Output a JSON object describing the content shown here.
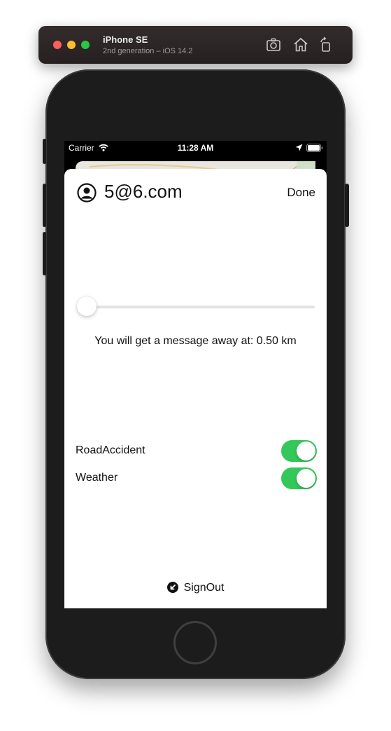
{
  "simulator": {
    "device_name": "iPhone SE",
    "device_detail": "2nd generation – iOS 14.2",
    "toolbar_icons": [
      "screenshot-icon",
      "home-icon",
      "rotate-icon"
    ]
  },
  "status_bar": {
    "carrier": "Carrier",
    "time": "11:28 AM",
    "icons": [
      "wifi-icon",
      "location-arrow-icon",
      "battery-icon"
    ]
  },
  "settings_sheet": {
    "user_email": "5@6.com",
    "done_label": "Done",
    "distance_slider": {
      "value": 0.0,
      "caption": "You will get a message away at: 0.50 km"
    },
    "toggles": [
      {
        "label": "RoadAccident",
        "on": true
      },
      {
        "label": "Weather",
        "on": true
      }
    ],
    "signout_label": "SignOut"
  },
  "colors": {
    "toggle_on": "#34c759",
    "slider_track": "#e3e3e6",
    "sheet_background": "#ffffff",
    "phone_body": "#1c1c1c"
  }
}
